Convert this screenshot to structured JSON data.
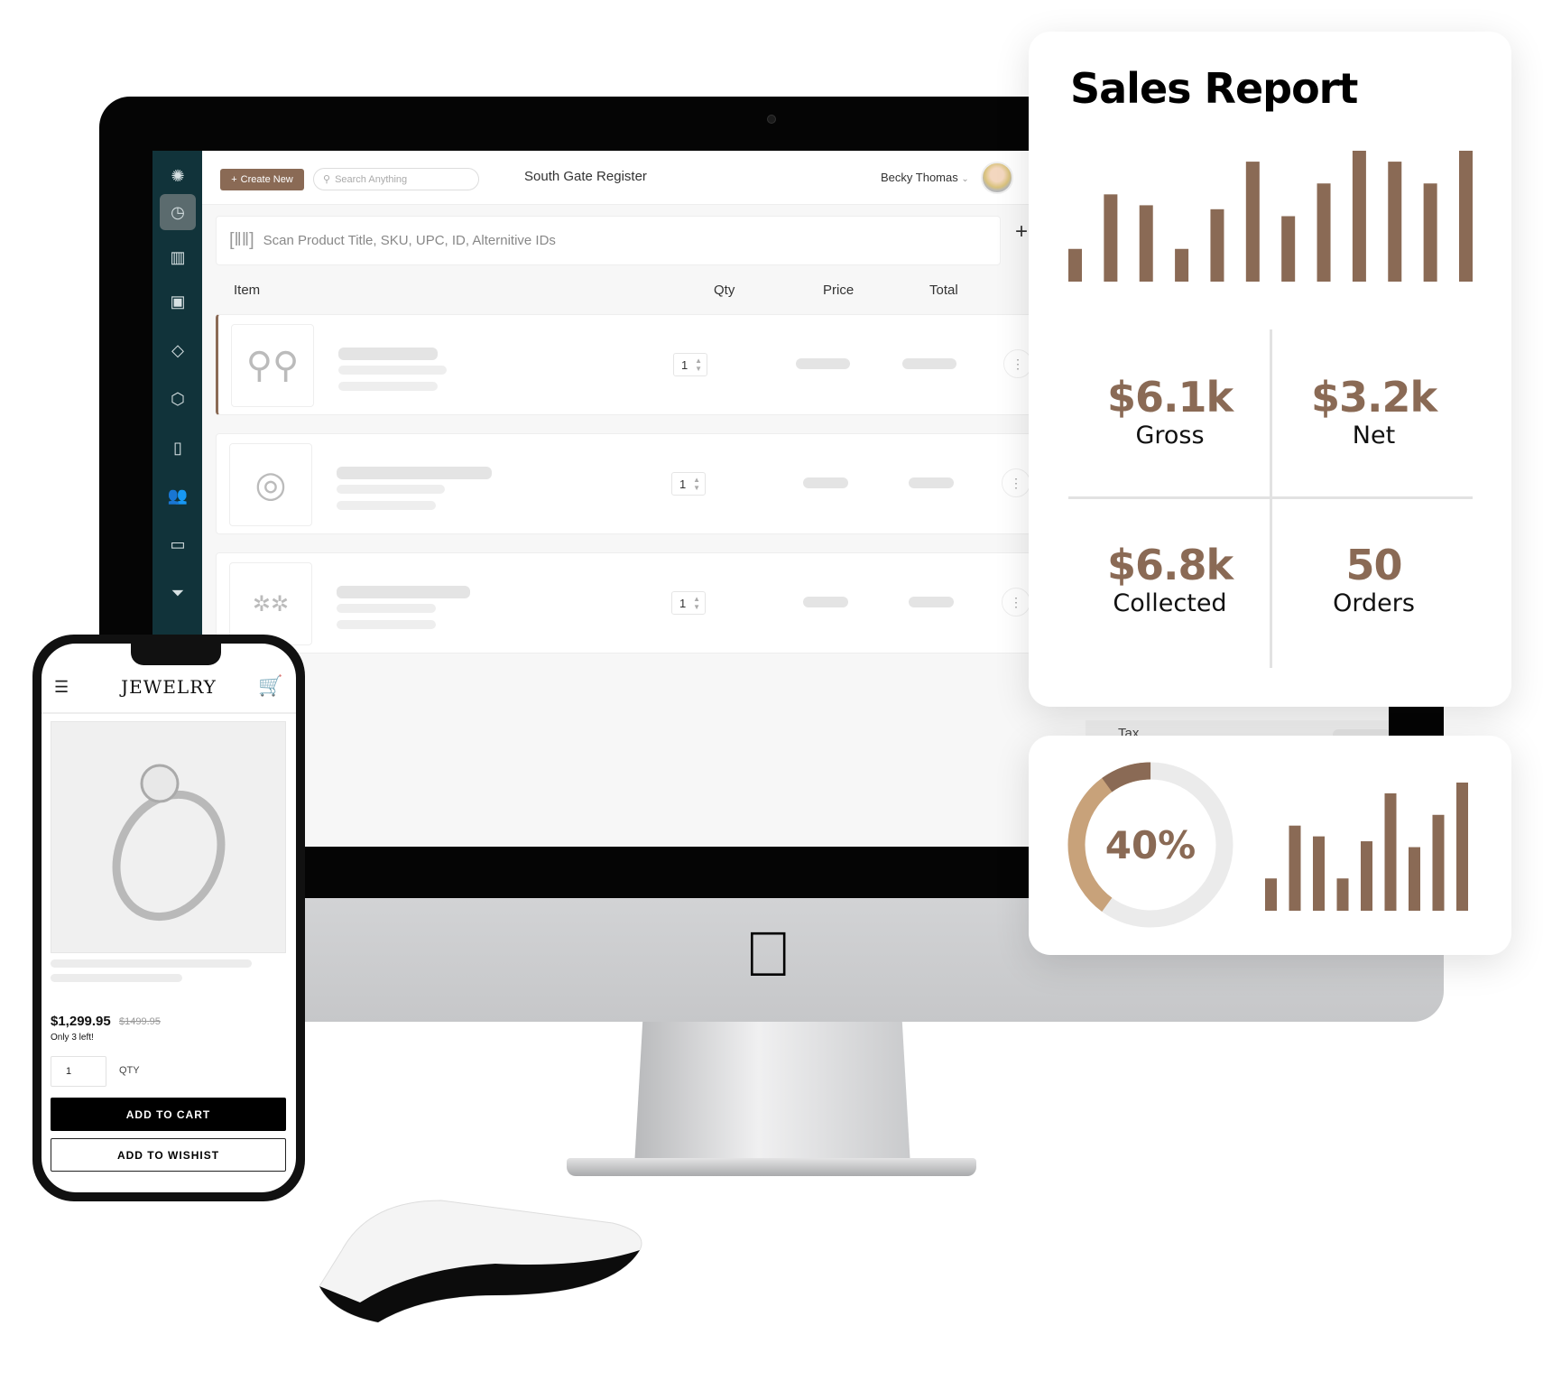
{
  "pos": {
    "create_new": "Create New",
    "search_placeholder": "Search Anything",
    "register": "South Gate Register",
    "user": "Becky Thomas",
    "scan_placeholder": "Scan Product Title, SKU, UPC, ID, Alternitive IDs",
    "columns": {
      "item": "Item",
      "qty": "Qty",
      "price": "Price",
      "total": "Total"
    },
    "rows": [
      {
        "product": "earrings",
        "qty": "1"
      },
      {
        "product": "pendant necklace",
        "qty": "1"
      },
      {
        "product": "stud earrings",
        "qty": "1"
      }
    ],
    "tax_label": "Tax",
    "sidebar_icons": [
      "logo-icon",
      "dashboard-icon",
      "barcode-icon",
      "register-icon",
      "tag-icon",
      "box-icon",
      "invoice-icon",
      "customers-icon",
      "window-icon",
      "filter-dollar-icon"
    ]
  },
  "sales_report": {
    "title": "Sales Report",
    "stats": [
      {
        "value": "$6.1k",
        "label": "Gross"
      },
      {
        "value": "$3.2k",
        "label": "Net"
      },
      {
        "value": "$6.8k",
        "label": "Collected"
      },
      {
        "value": "50",
        "label": "Orders"
      }
    ]
  },
  "chart_data": [
    {
      "type": "bar",
      "values": [
        33,
        88,
        77,
        33,
        73,
        121,
        66,
        99,
        132,
        121,
        99,
        132
      ],
      "color": "#8a6a55",
      "grid": false
    },
    {
      "type": "pie",
      "donut": true,
      "percent": 40,
      "label": "40%",
      "colors": [
        "#8a6a55",
        "#c8a27a",
        "#ebebeb"
      ]
    },
    {
      "type": "bar",
      "values": [
        33,
        87,
        76,
        33,
        71,
        120,
        65,
        98,
        131
      ],
      "color": "#8a6a55",
      "grid": false
    }
  ],
  "phone": {
    "brand": "Jewelry",
    "price": "$1,299.95",
    "old_price": "$1499.95",
    "stock": "Only 3 left!",
    "qty": "1",
    "qty_label": "QTY",
    "add_to_cart": "ADD TO CART",
    "add_to_wishlist": "ADD TO WISHIST"
  },
  "colors": {
    "brand": "#8a6a55",
    "sidebar": "#11333a"
  }
}
